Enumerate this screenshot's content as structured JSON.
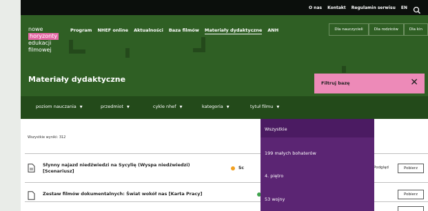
{
  "topbar": {
    "links": [
      "O nas",
      "Kontakt",
      "Regulamin serwisu"
    ],
    "lang": "EN",
    "search_icon": "search-icon"
  },
  "logo": {
    "line1": "nowe",
    "line2": "horyzonty",
    "line3": "edukacji",
    "line4": "filmowej"
  },
  "nav": [
    "Program",
    "NHEF online",
    "Aktualności",
    "Baza filmów",
    "Materiały dydaktyczne",
    "ANH"
  ],
  "nav_active_index": 4,
  "audience": [
    "Dla nauczycieli",
    "Dla rodziców",
    "Dla kin"
  ],
  "page_title": "Materiały dydaktyczne",
  "filter_button": {
    "label": "Filtruj bazę",
    "close_icon": "close-icon"
  },
  "filters": [
    {
      "label": "poziom nauczania"
    },
    {
      "label": "przedmiot"
    },
    {
      "label": "cykle nhef"
    },
    {
      "label": "kategoria"
    },
    {
      "label": "tytuł filmu"
    }
  ],
  "results_label": "Wszystkie wyniki: 312",
  "rows": [
    {
      "title_line1": "Słynny najazd niedźwiedzi na Sycylię (Wyspa niedźwiedzi)",
      "title_line2": "[Scenariusz]",
      "tag": "Sc",
      "tag_color": "#f2a020",
      "preview": "Podgląd",
      "download": "Pobierz"
    },
    {
      "title_line1": "Zestaw filmów dokumentalnych: Świat wokół nas [Karta Pracy]",
      "title_line2": "",
      "tag": "",
      "tag_color": "#3fa34d",
      "preview": "",
      "download": "Pobierz"
    }
  ],
  "dropdown": {
    "selected": "Wszystkie",
    "items": [
      "199 małych bohaterów",
      "4. piętro",
      "53 wojny"
    ]
  },
  "colors": {
    "header_green": "#2f5f24",
    "filter_bar": "#234a1a",
    "pink": "#ed8ab8",
    "dropdown_purple": "#5b2573"
  }
}
